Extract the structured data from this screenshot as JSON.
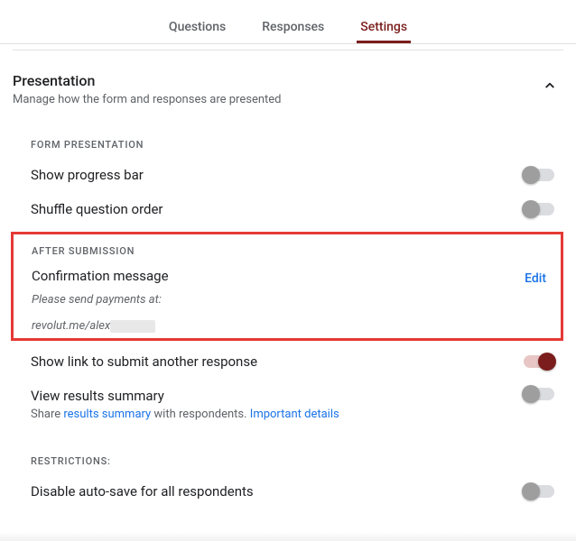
{
  "tabs": {
    "questions": "Questions",
    "responses": "Responses",
    "settings": "Settings"
  },
  "section": {
    "title": "Presentation",
    "subtitle": "Manage how the form and responses are presented"
  },
  "form_presentation": {
    "label": "FORM PRESENTATION",
    "progress_bar": "Show progress bar",
    "shuffle": "Shuffle question order"
  },
  "after_submission": {
    "label": "AFTER SUBMISSION",
    "confirmation_title": "Confirmation message",
    "confirmation_line1": "Please send payments at:",
    "confirmation_line2": "revolut.me/alex",
    "edit": "Edit",
    "submit_another": "Show link to submit another response",
    "view_results": "View results summary",
    "view_results_sub_pre": "Share ",
    "view_results_link1": "results summary",
    "view_results_sub_mid": " with respondents. ",
    "view_results_link2": "Important details"
  },
  "restrictions": {
    "label": "RESTRICTIONS:",
    "auto_save": "Disable auto-save for all respondents"
  }
}
